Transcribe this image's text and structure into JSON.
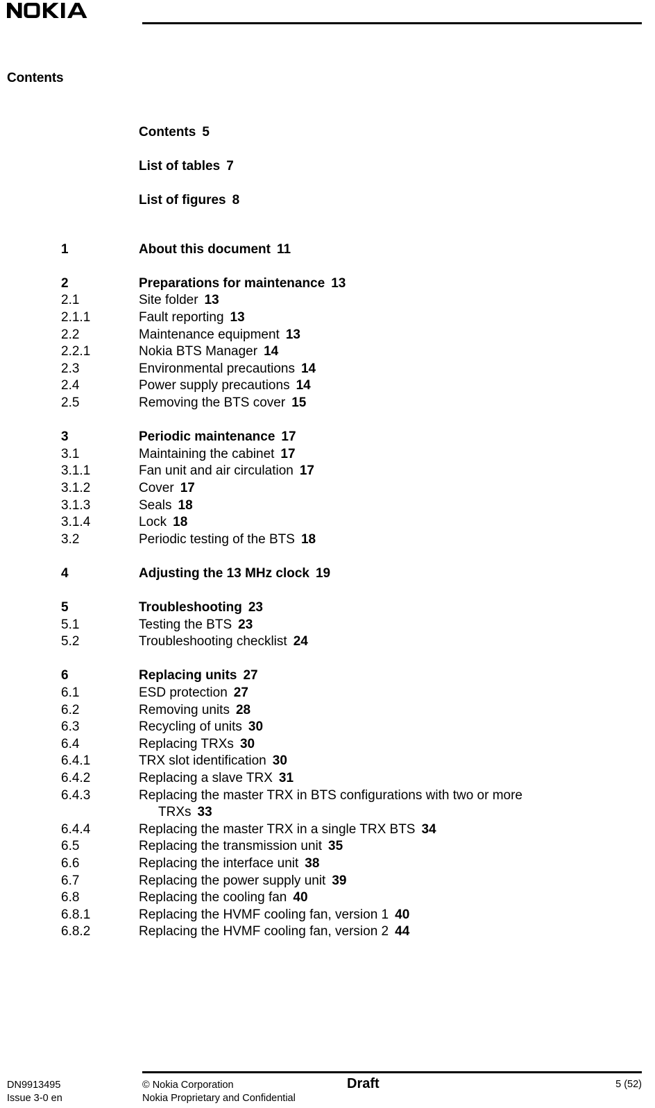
{
  "header": {
    "logo_text": "NOKIA",
    "logo_icon": "nokia-wordmark-logo"
  },
  "page_title": "Contents",
  "toc": {
    "front_matter": [
      {
        "title": "Contents",
        "page": "5"
      },
      {
        "title": "List of tables",
        "page": "7"
      },
      {
        "title": "List of figures",
        "page": "8"
      }
    ],
    "groups": [
      {
        "entries": [
          {
            "num": "1",
            "title": "About this document",
            "page": "11",
            "bold": true
          }
        ]
      },
      {
        "entries": [
          {
            "num": "2",
            "title": "Preparations for maintenance",
            "page": "13",
            "bold": true
          },
          {
            "num": "2.1",
            "title": "Site folder",
            "page": "13",
            "bold": false
          },
          {
            "num": "2.1.1",
            "title": "Fault reporting",
            "page": "13",
            "bold": false
          },
          {
            "num": "2.2",
            "title": "Maintenance equipment",
            "page": "13",
            "bold": false
          },
          {
            "num": "2.2.1",
            "title": "Nokia BTS Manager",
            "page": "14",
            "bold": false
          },
          {
            "num": "2.3",
            "title": "Environmental precautions",
            "page": "14",
            "bold": false
          },
          {
            "num": "2.4",
            "title": "Power supply precautions",
            "page": "14",
            "bold": false
          },
          {
            "num": "2.5",
            "title": "Removing the BTS cover",
            "page": "15",
            "bold": false
          }
        ]
      },
      {
        "entries": [
          {
            "num": "3",
            "title": "Periodic maintenance",
            "page": "17",
            "bold": true
          },
          {
            "num": "3.1",
            "title": "Maintaining the cabinet",
            "page": "17",
            "bold": false
          },
          {
            "num": "3.1.1",
            "title": "Fan unit and air circulation",
            "page": "17",
            "bold": false
          },
          {
            "num": "3.1.2",
            "title": "Cover",
            "page": "17",
            "bold": false
          },
          {
            "num": "3.1.3",
            "title": "Seals",
            "page": "18",
            "bold": false
          },
          {
            "num": "3.1.4",
            "title": "Lock",
            "page": "18",
            "bold": false
          },
          {
            "num": "3.2",
            "title": "Periodic testing of the BTS",
            "page": "18",
            "bold": false
          }
        ]
      },
      {
        "entries": [
          {
            "num": "4",
            "title": "Adjusting the 13 MHz clock",
            "page": "19",
            "bold": true
          }
        ]
      },
      {
        "entries": [
          {
            "num": "5",
            "title": "Troubleshooting",
            "page": "23",
            "bold": true
          },
          {
            "num": "5.1",
            "title": "Testing the BTS",
            "page": "23",
            "bold": false
          },
          {
            "num": "5.2",
            "title": "Troubleshooting checklist",
            "page": "24",
            "bold": false
          }
        ]
      },
      {
        "entries": [
          {
            "num": "6",
            "title": "Replacing units",
            "page": "27",
            "bold": true
          },
          {
            "num": "6.1",
            "title": "ESD protection",
            "page": "27",
            "bold": false
          },
          {
            "num": "6.2",
            "title": "Removing units",
            "page": "28",
            "bold": false
          },
          {
            "num": "6.3",
            "title": "Recycling of units",
            "page": "30",
            "bold": false
          },
          {
            "num": "6.4",
            "title": "Replacing TRXs",
            "page": "30",
            "bold": false
          },
          {
            "num": "6.4.1",
            "title": "TRX slot identification",
            "page": "30",
            "bold": false
          },
          {
            "num": "6.4.2",
            "title": "Replacing a slave TRX",
            "page": "31",
            "bold": false
          },
          {
            "num": "6.4.3",
            "title": "Replacing the master TRX in BTS configurations with two or more",
            "page": "",
            "bold": false
          },
          {
            "num": "",
            "title": "TRXs",
            "page": "33",
            "bold": false,
            "continuation": true
          },
          {
            "num": "6.4.4",
            "title": "Replacing the master TRX in a single TRX BTS",
            "page": "34",
            "bold": false
          },
          {
            "num": "6.5",
            "title": "Replacing the transmission unit",
            "page": "35",
            "bold": false
          },
          {
            "num": "6.6",
            "title": "Replacing the interface unit",
            "page": "38",
            "bold": false
          },
          {
            "num": "6.7",
            "title": "Replacing the power supply unit",
            "page": "39",
            "bold": false
          },
          {
            "num": "6.8",
            "title": "Replacing the cooling fan",
            "page": "40",
            "bold": false
          },
          {
            "num": "6.8.1",
            "title": "Replacing the HVMF cooling fan, version 1",
            "page": "40",
            "bold": false
          },
          {
            "num": "6.8.2",
            "title": "Replacing the HVMF cooling fan, version 2",
            "page": "44",
            "bold": false
          }
        ]
      }
    ]
  },
  "footer": {
    "document_id": "DN9913495",
    "issue": "Issue 3-0 en",
    "copyright": "© Nokia Corporation",
    "confidentiality": "Nokia Proprietary and Confidential",
    "status": "Draft",
    "page_number": "5 (52)"
  }
}
